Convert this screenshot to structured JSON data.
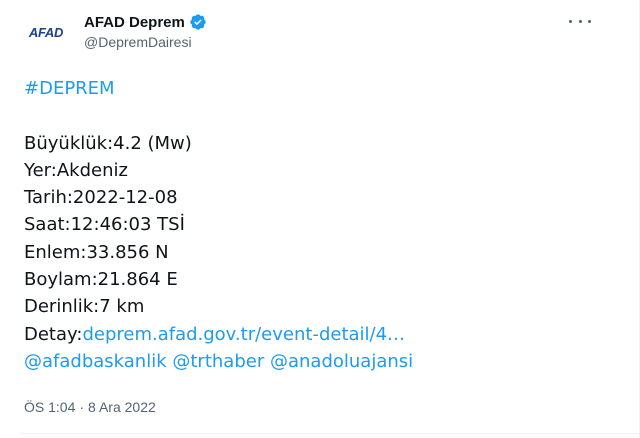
{
  "author": {
    "avatar_text": "AFAD",
    "display_name": "AFAD Deprem",
    "handle": "@DepremDairesi",
    "verified_color": "#1d9bf0"
  },
  "tweet": {
    "hashtag": "#DEPREM",
    "lines": {
      "magnitude": "Büyüklük:4.2 (Mw)",
      "location": "Yer:Akdeniz",
      "date": "Tarih:2022-12-08",
      "time": "Saat:12:46:03 TSİ",
      "latitude": "Enlem:33.856 N",
      "longitude": "Boylam:21.864 E",
      "depth": "Derinlik:7 km",
      "detail_label": "Detay:",
      "detail_link": "deprem.afad.gov.tr/event-detail/4…"
    },
    "mentions": [
      "@afadbaskanlik",
      "@trthaber",
      "@anadoluajansi"
    ],
    "time": "ÖS 1:04",
    "separator": "·",
    "date": "8 Ara 2022"
  },
  "colors": {
    "link": "#1d9bf0",
    "text": "#0f1419",
    "secondary": "#536471",
    "afad_blue": "#1d3f8f",
    "afad_red": "#e2231a"
  },
  "icons": {
    "verified": "verified-badge-icon",
    "more": "more-options-icon"
  }
}
